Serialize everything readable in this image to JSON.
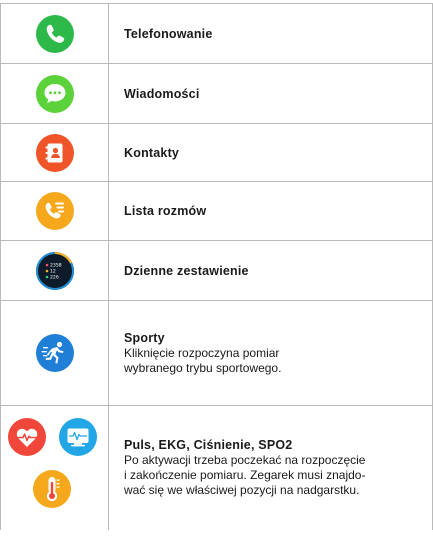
{
  "rows": [
    {
      "icon": "phone-icon",
      "color": "#2db84a",
      "title": "Telefonowanie"
    },
    {
      "icon": "message-icon",
      "color": "#5bd23a",
      "title": "Wiadomości"
    },
    {
      "icon": "contacts-icon",
      "color": "#f0552a",
      "title": "Kontakty"
    },
    {
      "icon": "call-list-icon",
      "color": "#f6a81c",
      "title": "Lista rozmów"
    },
    {
      "icon": "daily-summary-icon",
      "color": "#0d1b2a",
      "title": "Dzienne zestawienie"
    },
    {
      "icon": "running-icon",
      "color": "#1f7fd6",
      "title": "Sporty",
      "description": [
        "Kliknięcie rozpoczyna pomiar",
        "wybranego trybu sportowego."
      ]
    },
    {
      "icons": [
        "heart-rate-icon",
        "ekg-icon",
        "thermometer-icon"
      ],
      "title": "Puls, EKG, Ciśnienie, SPO2",
      "description": [
        "Po aktywacji trzeba poczekać na rozpoczęcie",
        "i zakończenie pomiaru. Zegarek musi znajdo-",
        "wać się we właściwej pozycji na nadgarstku."
      ]
    }
  ],
  "summary_values": [
    "2358",
    "12",
    "226"
  ]
}
